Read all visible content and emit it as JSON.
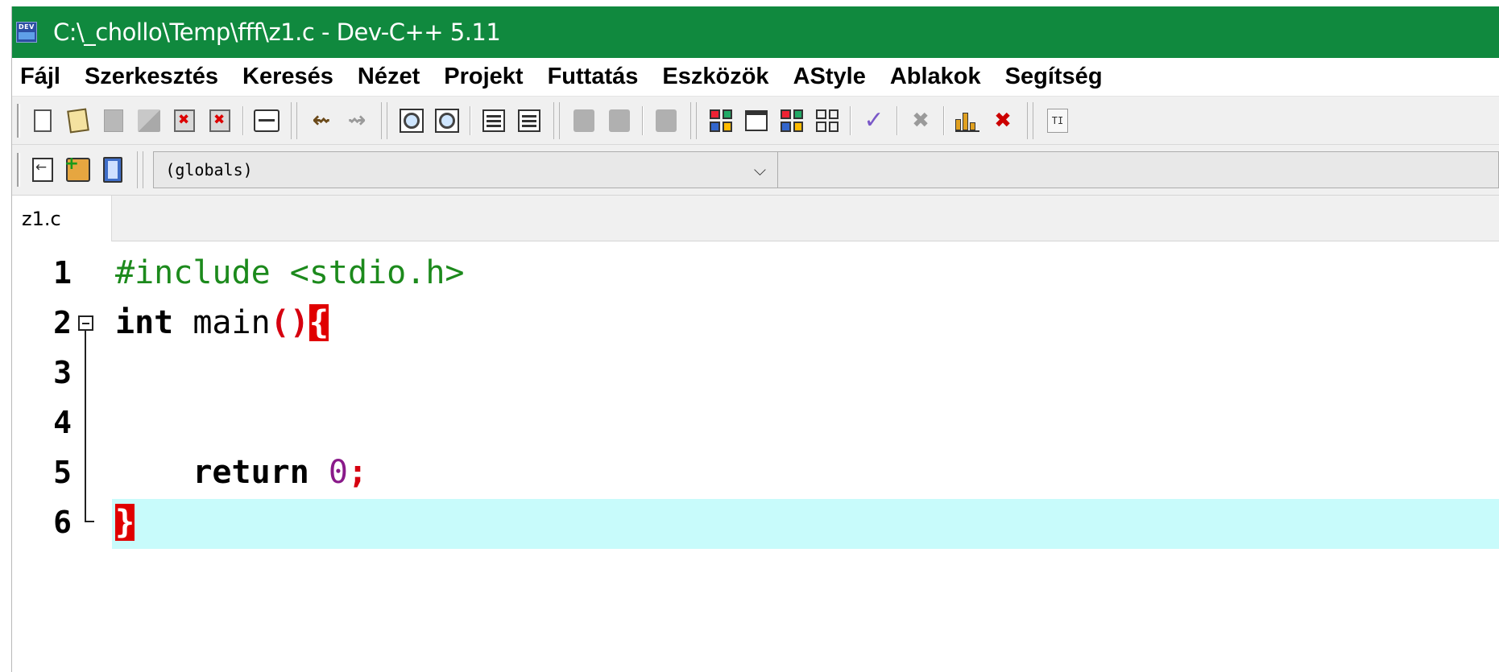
{
  "window": {
    "title": "C:\\_chollo\\Temp\\fff\\z1.c - Dev-C++ 5.11",
    "title_bar_color": "#10893e",
    "app_icon_text": "DEV"
  },
  "menu": {
    "items": [
      "Fájl",
      "Szerkesztés",
      "Keresés",
      "Nézet",
      "Projekt",
      "Futtatás",
      "Eszközök",
      "AStyle",
      "Ablakok",
      "Segítség"
    ]
  },
  "toolbar1": {
    "icons": [
      "new-file-icon",
      "open-file-icon",
      "save-icon",
      "save-all-icon",
      "close-file-icon",
      "close-all-icon",
      "print-icon",
      "undo-icon",
      "redo-icon",
      "find-icon",
      "replace-icon",
      "indent-icon",
      "unindent-icon",
      "toggle-bookmark-icon",
      "goto-bookmark-icon",
      "comment-icon",
      "compile-icon",
      "run-icon",
      "compile-run-icon",
      "rebuild-all-icon",
      "syntax-check-icon",
      "stop-icon",
      "profile-icon",
      "delete-profile-icon",
      "tdm-gcc-icon"
    ],
    "tt_label": "TI"
  },
  "toolbar2": {
    "icons": [
      "insert-icon",
      "add-to-project-icon",
      "book-icon"
    ],
    "scope_combo_value": "(globals)",
    "scope_combo_arrow": "⌵"
  },
  "tabs": [
    {
      "label": "z1.c",
      "active": true
    }
  ],
  "editor": {
    "current_line_color": "#c8fbfb",
    "lines": [
      {
        "number": "1"
      },
      {
        "number": "2"
      },
      {
        "number": "3"
      },
      {
        "number": "4"
      },
      {
        "number": "5"
      },
      {
        "number": "6"
      }
    ],
    "tokens": {
      "l1_pre": "#include <stdio.h>",
      "l2_kw": "int",
      "l2_name": " main",
      "l2_paren": "()",
      "l2_brace": "{",
      "l5_indent": "    ",
      "l5_kw": "return",
      "l5_num": "0",
      "l5_semi": ";",
      "l6_brace": "}"
    }
  }
}
